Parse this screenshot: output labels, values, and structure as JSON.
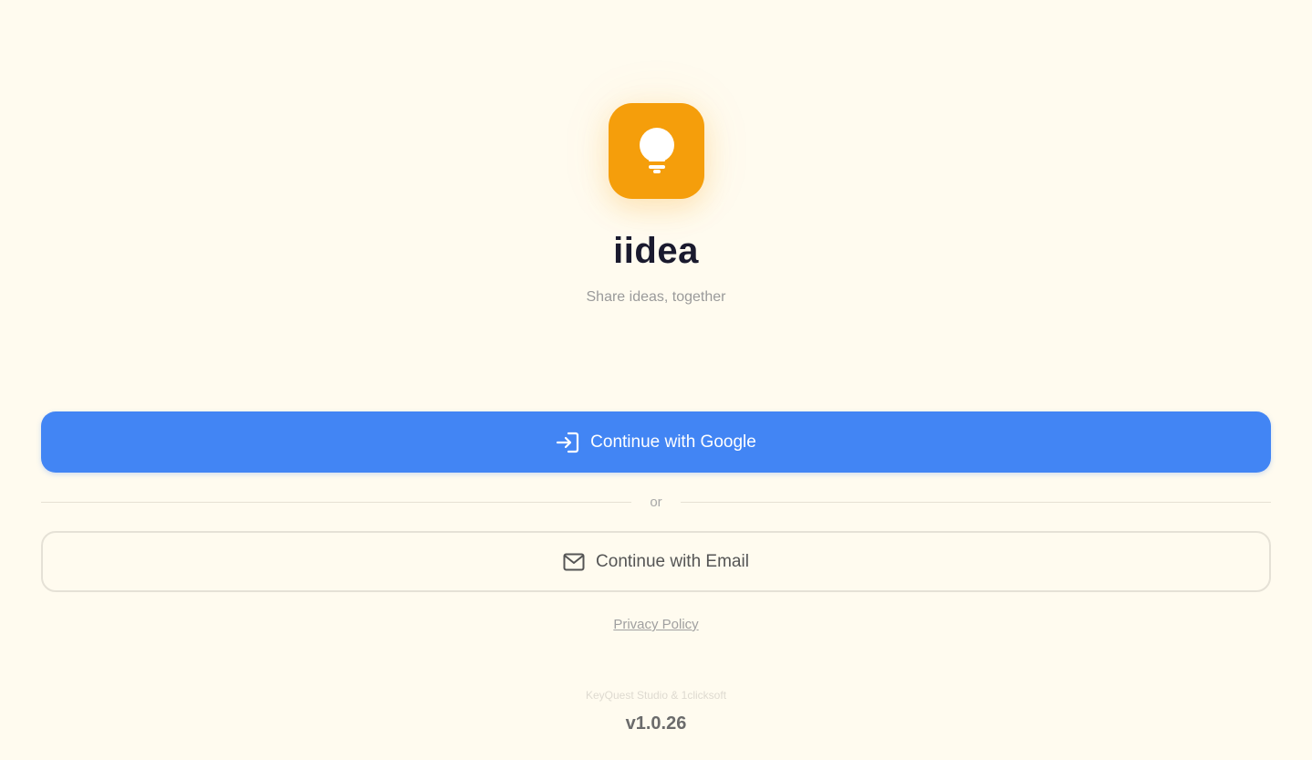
{
  "brand": {
    "app_name": "iidea",
    "tagline": "Share ideas, together",
    "logo_icon": "lightbulb-icon",
    "accent_color": "#f59e0b"
  },
  "auth": {
    "google_label": "Continue with Google",
    "google_icon": "sign-in-icon",
    "google_color": "#4285f4",
    "divider_label": "or",
    "email_label": "Continue with Email",
    "email_icon": "mail-icon"
  },
  "footer": {
    "privacy_label": "Privacy Policy",
    "credits": "KeyQuest Studio & 1clicksoft",
    "version": "v1.0.26"
  }
}
